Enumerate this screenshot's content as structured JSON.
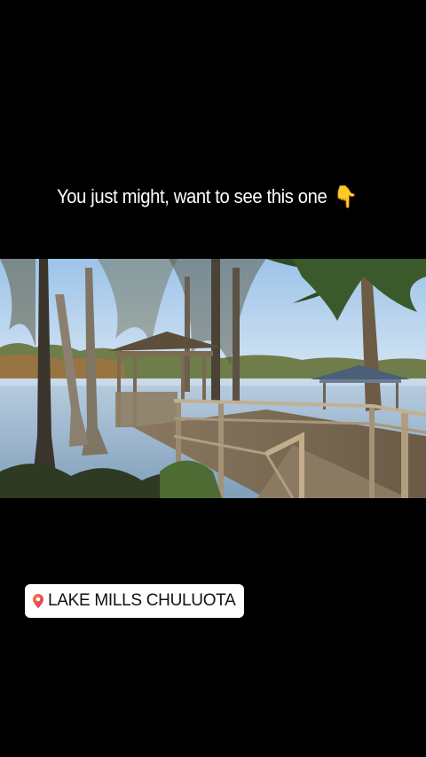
{
  "story": {
    "caption_text": "You just might, want to see this one",
    "caption_emoji": "👇",
    "location_sticker": {
      "label": "LAKE MILLS CHULUOTA",
      "icon": "location-pin-icon"
    }
  },
  "photo": {
    "subject": "lake-dock-scene"
  },
  "colors": {
    "background": "#000000",
    "caption_text": "#ffffff",
    "sticker_background": "#ffffff",
    "sticker_text": "#111111",
    "pin_gradient_start": "#f58529",
    "pin_gradient_end": "#dd2a7b"
  }
}
